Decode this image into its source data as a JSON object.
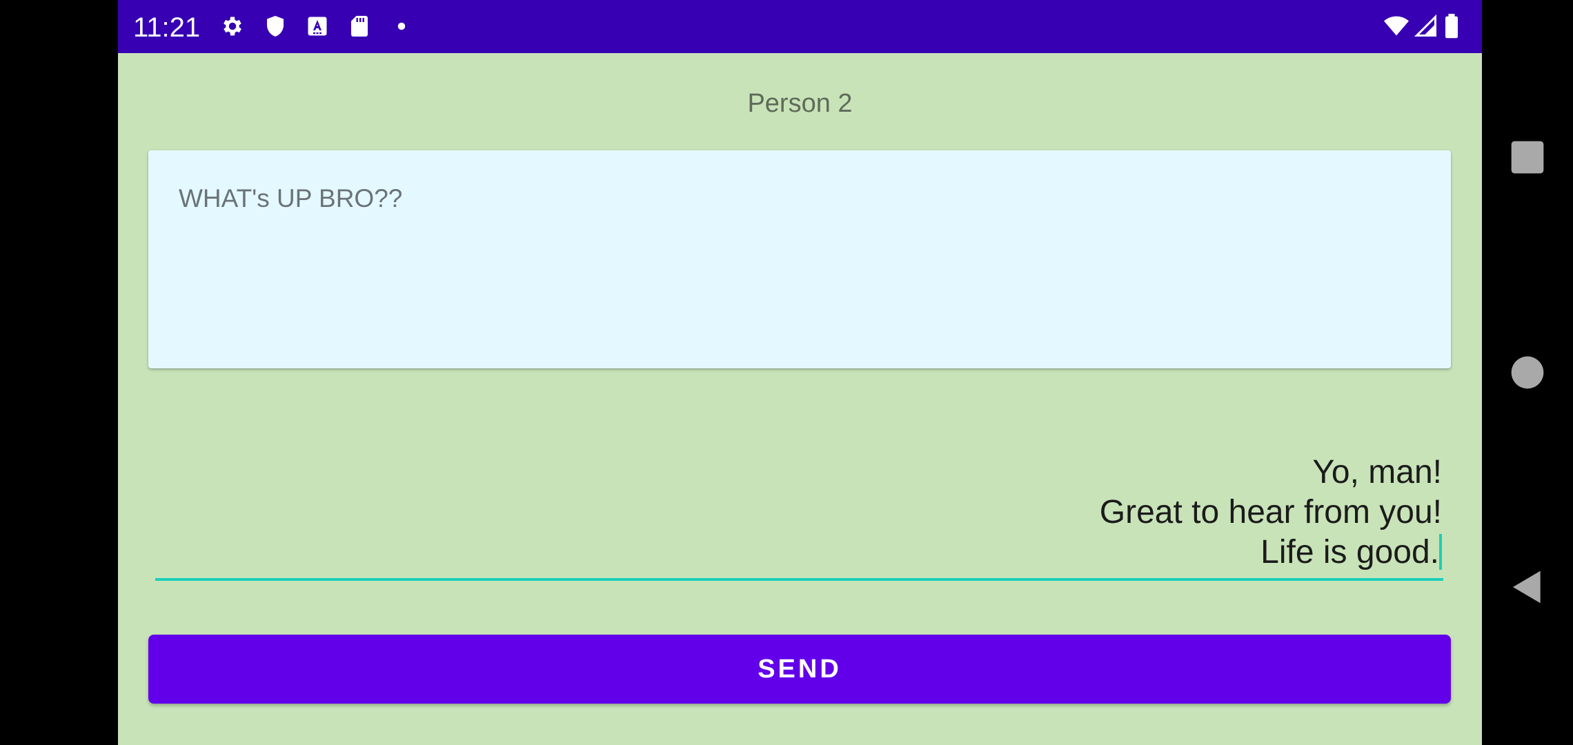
{
  "status_bar": {
    "time": "11:21",
    "left_icons": [
      "gear-icon",
      "shield-icon",
      "font-a-icon",
      "sd-card-icon",
      "dot-icon"
    ],
    "right_icons": [
      "wifi-icon",
      "signal-icon",
      "battery-icon"
    ],
    "background": "#3700b3"
  },
  "header": {
    "title": "Person 2"
  },
  "received": {
    "message": "WHAT's UP BRO??"
  },
  "compose": {
    "lines": [
      "Yo, man!",
      "Great to hear from you!",
      "Life is good."
    ],
    "underline_color": "#1ccfb8"
  },
  "actions": {
    "send_label": "SEND",
    "send_color": "#6200ea"
  },
  "navigation": {
    "buttons": [
      "recents-square-icon",
      "home-circle-icon",
      "back-triangle-icon"
    ]
  },
  "colors": {
    "screen_background": "#c8e3b8",
    "card_background": "#e4f9ff"
  }
}
